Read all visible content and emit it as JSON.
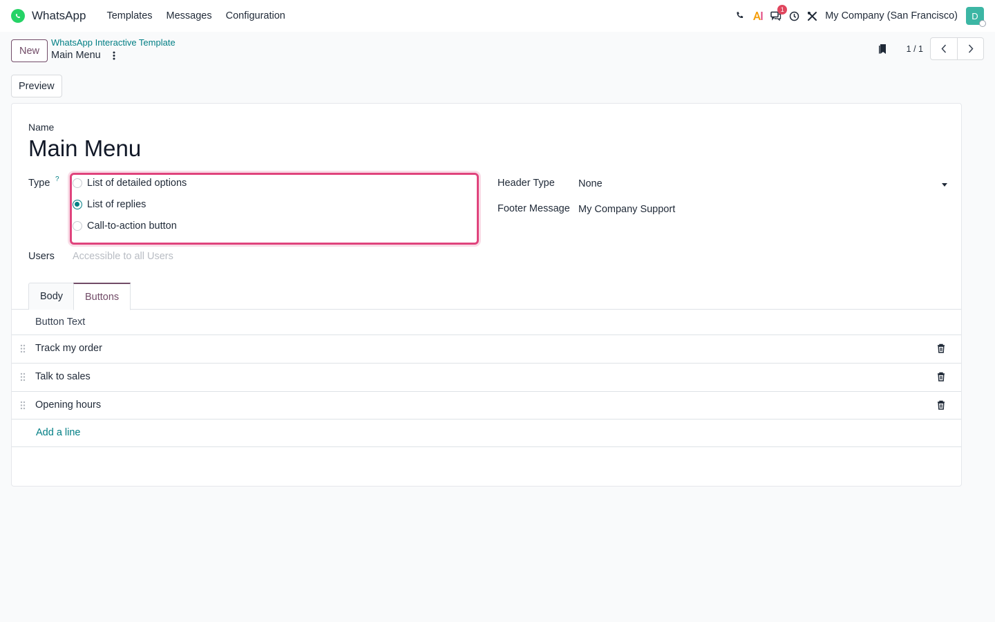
{
  "navbar": {
    "app_name": "WhatsApp",
    "menu": [
      "Templates",
      "Messages",
      "Configuration"
    ],
    "company": "My Company (San Francisco)",
    "avatar_initial": "D",
    "messages_badge": "1",
    "icons": [
      "phone-icon",
      "ai-icon",
      "chat-icon",
      "clock-icon",
      "tools-icon"
    ]
  },
  "control_panel": {
    "new_label": "New",
    "breadcrumb_parent": "WhatsApp Interactive Template",
    "breadcrumb_current": "Main Menu",
    "pager_value": "1 / 1"
  },
  "actions": {
    "preview_label": "Preview"
  },
  "form": {
    "name_label": "Name",
    "name_value": "Main Menu",
    "type_label": "Type",
    "type_help": "?",
    "type_options": [
      {
        "label": "List of detailed options",
        "checked": false
      },
      {
        "label": "List of replies",
        "checked": true
      },
      {
        "label": "Call-to-action button",
        "checked": false
      }
    ],
    "users_label": "Users",
    "users_placeholder": "Accessible to all Users",
    "header_type_label": "Header Type",
    "header_type_value": "None",
    "footer_label": "Footer Message",
    "footer_value": "My Company Support"
  },
  "tabs": {
    "items": [
      "Body",
      "Buttons"
    ],
    "active": "Buttons"
  },
  "buttons_list": {
    "column": "Button Text",
    "rows": [
      "Track my order",
      "Talk to sales",
      "Opening hours"
    ],
    "add_line": "Add a line"
  },
  "colors": {
    "brand_purple": "#714b67",
    "teal_link": "#017e84",
    "highlight_pink": "#e0437c",
    "whatsapp_green": "#25d366"
  }
}
